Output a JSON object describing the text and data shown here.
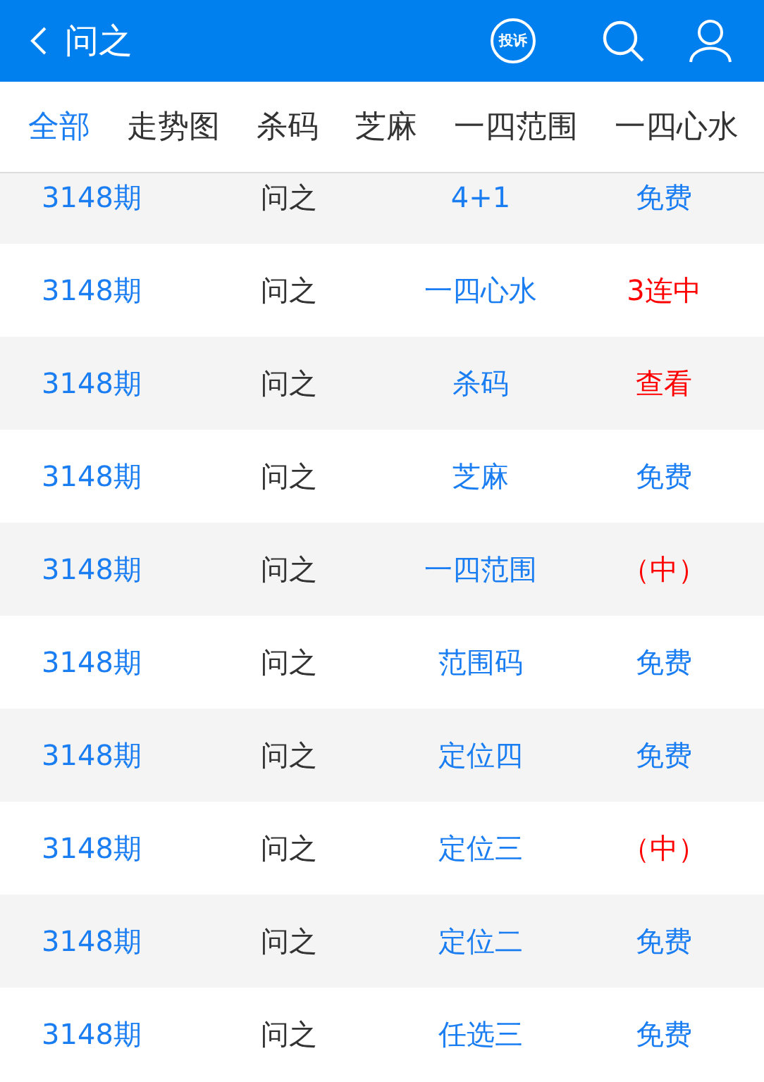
{
  "header": {
    "title": "问之",
    "complaint_badge": "投诉"
  },
  "tabs": [
    {
      "label": "全部",
      "selected": true
    },
    {
      "label": "走势图",
      "selected": false
    },
    {
      "label": "杀码",
      "selected": false
    },
    {
      "label": "芝麻",
      "selected": false
    },
    {
      "label": "一四范围",
      "selected": false
    },
    {
      "label": "一四心水",
      "selected": false
    }
  ],
  "rows": [
    {
      "period": "3148期",
      "author": "问之",
      "category": "4+1",
      "result": "免费",
      "color": "#1a7ef2"
    },
    {
      "period": "3148期",
      "author": "问之",
      "category": "一四心水",
      "result": "3连中",
      "color": "#ff0000"
    },
    {
      "period": "3148期",
      "author": "问之",
      "category": "杀码",
      "result": "查看",
      "color": "#ff0000"
    },
    {
      "period": "3148期",
      "author": "问之",
      "category": "芝麻",
      "result": "免费",
      "color": "#1a7ef2"
    },
    {
      "period": "3148期",
      "author": "问之",
      "category": "一四范围",
      "result": "（中）",
      "color": "#ff0000"
    },
    {
      "period": "3148期",
      "author": "问之",
      "category": "范围码",
      "result": "免费",
      "color": "#1a7ef2"
    },
    {
      "period": "3148期",
      "author": "问之",
      "category": "定位四",
      "result": "免费",
      "color": "#1a7ef2"
    },
    {
      "period": "3148期",
      "author": "问之",
      "category": "定位三",
      "result": "（中）",
      "color": "#ff0000"
    },
    {
      "period": "3148期",
      "author": "问之",
      "category": "定位二",
      "result": "免费",
      "color": "#1a7ef2"
    },
    {
      "period": "3148期",
      "author": "问之",
      "category": "任选三",
      "result": "免费",
      "color": "#1a7ef2"
    }
  ]
}
